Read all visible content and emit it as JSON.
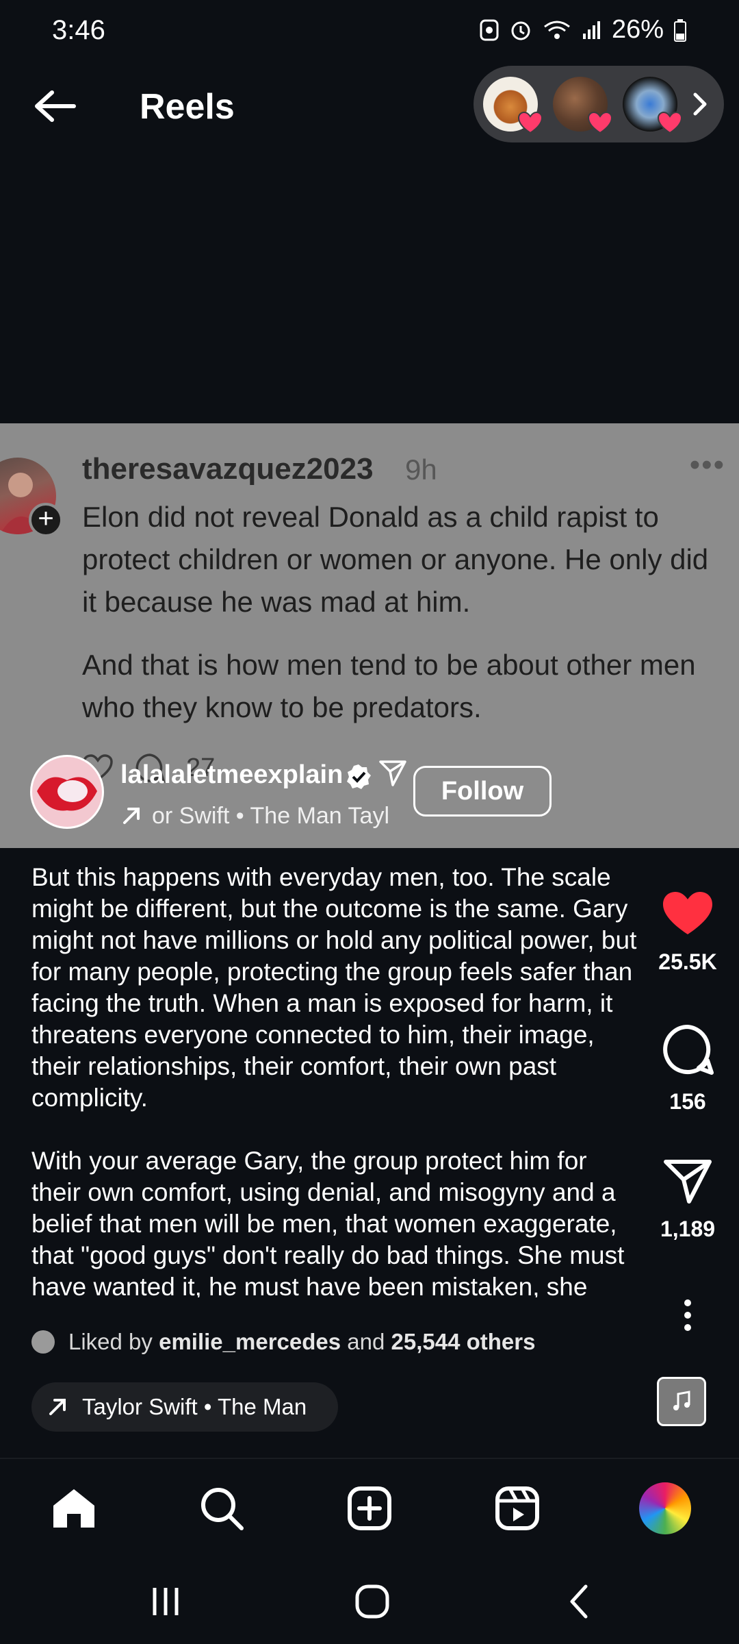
{
  "status_bar": {
    "time": "3:46",
    "battery": "26%"
  },
  "header": {
    "title": "Reels",
    "friend_avatars": [
      "friend-1",
      "friend-2",
      "friend-3"
    ]
  },
  "post": {
    "username": "theresavazquez2023",
    "time": "9h",
    "paragraphs": [
      "Elon did not reveal Donald as a child rapist to protect children or women or anyone. He only did it because he was mad at him.",
      "And that is how men tend to be about other men who they know to be predators."
    ],
    "comment_count": "27"
  },
  "reel": {
    "author": "lalalaletmeexplain",
    "follow_label": "Follow",
    "audio_short": "or Swift • The Man    Tayl",
    "caption_paragraphs": [
      "But this happens with everyday men, too. The scale might be different, but the outcome is the same. Gary might not have millions or hold any political power, but for many people, protecting the group feels safer than facing the truth. When a man is exposed for harm, it threatens everyone connected to him, their image, their relationships, their comfort, their own past complicity.",
      "With your average Gary, the group protect him for their own comfort, using denial, and misogyny and a belief that men will be men, that women exaggerate, that \"good guys\" don't really do bad things. She must have wanted it, he must have been mistaken, she must be lying, she must..."
    ],
    "likes": "25.5K",
    "comments": "156",
    "shares": "1,189",
    "liked_by_prefix": "Liked by",
    "liked_by_user": "emilie_mercedes",
    "liked_by_and": "and",
    "liked_by_others": "25,544 others",
    "audio_label": "Taylor Swift • The Man"
  },
  "colors": {
    "background": "#0c0f14",
    "post_card": "#8c8c8c",
    "like_red": "#ff3040"
  }
}
